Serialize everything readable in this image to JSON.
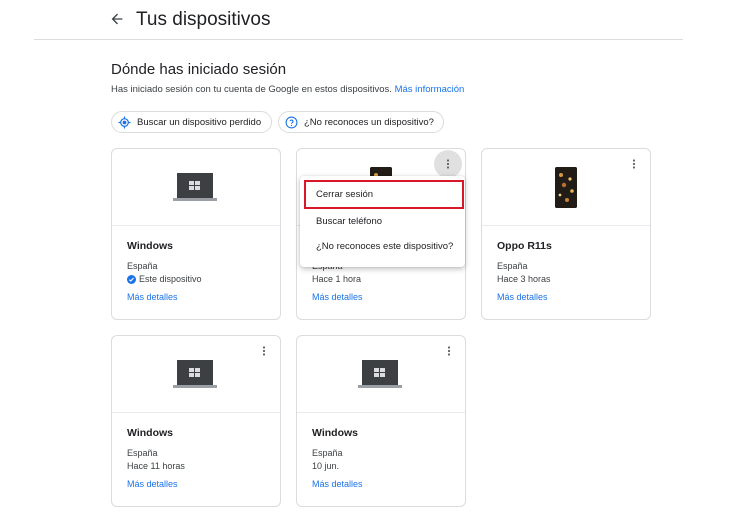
{
  "header": {
    "title": "Tus dispositivos",
    "back_icon": "arrow-back-icon"
  },
  "section": {
    "title": "Dónde has iniciado sesión",
    "description": "Has iniciado sesión con tu cuenta de Google en estos dispositivos.",
    "more_info_link": "Más información"
  },
  "chips": [
    {
      "label": "Buscar un dispositivo perdido",
      "icon": "locate-icon",
      "color": "#1a73e8"
    },
    {
      "label": "¿No reconoces un dispositivo?",
      "icon": "help-circle-icon",
      "color": "#1a73e8"
    }
  ],
  "devices": [
    {
      "name": "Windows",
      "location": "España",
      "time": "Este dispositivo",
      "current": true,
      "details": "Más detalles",
      "type": "laptop"
    },
    {
      "name": "",
      "location": "España",
      "time": "Hace 1 hora",
      "details": "Más detalles",
      "type": "phone"
    },
    {
      "name": "Oppo R11s",
      "location": "España",
      "time": "Hace 3 horas",
      "details": "Más detalles",
      "type": "phone"
    },
    {
      "name": "Windows",
      "location": "España",
      "time": "Hace 11 horas",
      "details": "Más detalles",
      "type": "laptop"
    },
    {
      "name": "Windows",
      "location": "España",
      "time": "10 jun.",
      "details": "Más detalles",
      "type": "laptop"
    }
  ],
  "menu": {
    "items": [
      "Cerrar sesión",
      "Buscar teléfono",
      "¿No reconoces este dispositivo?"
    ],
    "highlighted_item": "Cerrar sesión",
    "highlight_color": "#d9172b"
  },
  "colors": {
    "accent": "#1a73e8",
    "text": "#202124",
    "border": "#dadce0"
  }
}
